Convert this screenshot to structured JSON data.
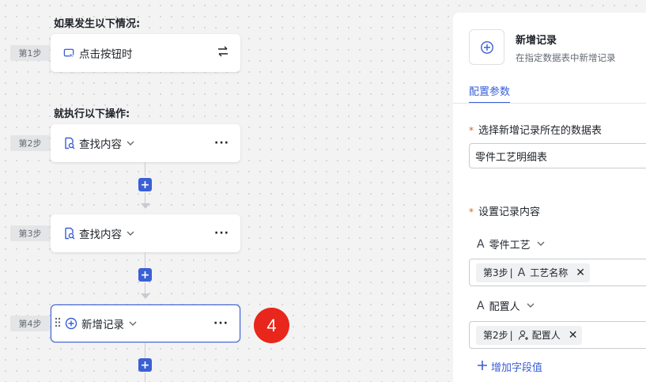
{
  "flow": {
    "trigger_heading": "如果发生以下情况:",
    "action_heading": "就执行以下操作:",
    "steps": [
      {
        "tag": "第1步",
        "label": "点击按钮时",
        "icon": "cursor-click-icon"
      },
      {
        "tag": "第2步",
        "label": "查找内容",
        "icon": "search-doc-icon"
      },
      {
        "tag": "第3步",
        "label": "查找内容",
        "icon": "search-doc-icon"
      },
      {
        "tag": "第4步",
        "label": "新增记录",
        "icon": "add-circle-icon"
      }
    ],
    "more_label": "···",
    "add_label": "+",
    "badge": "4"
  },
  "panel": {
    "title": "新增记录",
    "subtitle": "在指定数据表中新增记录",
    "tab": "配置参数",
    "table_label": "选择新增记录所在的数据表",
    "required_mark": "*",
    "table_value": "零件工艺明细表",
    "content_label": "设置记录内容",
    "fields": [
      {
        "name": "零件工艺",
        "chip_step": "第3步",
        "chip_sep": "|",
        "chip_value": "工艺名称",
        "chip_icon": "text-a-icon"
      },
      {
        "name": "配置人",
        "chip_step": "第2步",
        "chip_sep": "|",
        "chip_value": "配置人",
        "chip_icon": "person-add-icon"
      }
    ],
    "field_type_glyph": "A",
    "add_field_label": "增加字段值",
    "remove_glyph": "✕"
  },
  "colors": {
    "accent": "#3a5fd6",
    "badge": "#e8261b",
    "required": "#d1662b"
  }
}
